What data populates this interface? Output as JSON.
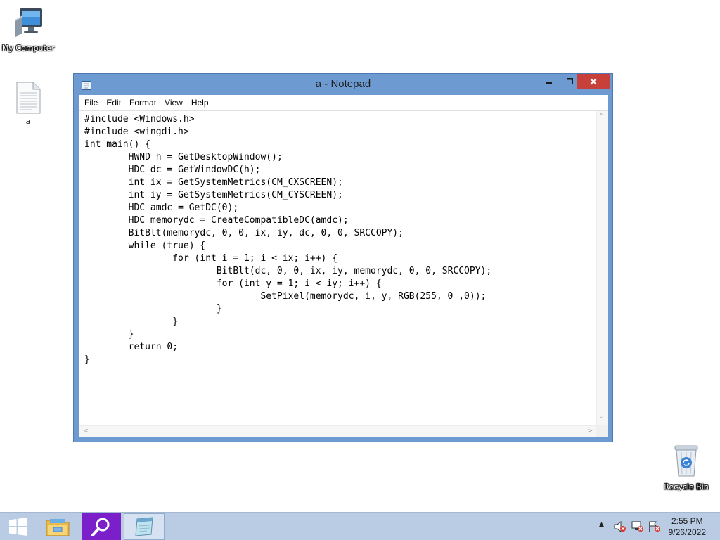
{
  "desktop": {
    "icons": [
      {
        "label": "My Computer",
        "icon": "computer-icon"
      },
      {
        "label": "a",
        "icon": "text-document-icon"
      },
      {
        "label": "Recycle Bin",
        "icon": "recycle-bin-icon"
      }
    ]
  },
  "window": {
    "title": "a - Notepad",
    "app_icon": "notepad-icon",
    "controls": {
      "minimize": "minimize-icon",
      "maximize": "maximize-icon",
      "close": "close-icon"
    },
    "menu": [
      "File",
      "Edit",
      "Format",
      "View",
      "Help"
    ],
    "content": "#include <Windows.h>\n#include <wingdi.h>\nint main() {\n\tHWND h = GetDesktopWindow();\n\tHDC dc = GetWindowDC(h);\n\tint ix = GetSystemMetrics(CM_CXSCREEN);\n\tint iy = GetSystemMetrics(CM_CYSCREEN);\n\tHDC amdc = GetDC(0);\n\tHDC memorydc = CreateCompatibleDC(amdc);\n\tBitBlt(memorydc, 0, 0, ix, iy, dc, 0, 0, SRCCOPY);\n\twhile (true) {\n\t\tfor (int i = 1; i < ix; i++) {\n\t\t\tBitBlt(dc, 0, 0, ix, iy, memorydc, 0, 0, SRCCOPY);\n\t\t\tfor (int y = 1; i < iy; i++) {\n\t\t\t\tSetPixel(memorydc, i, y, RGB(255, 0 ,0));\n\t\t\t}\n\t\t}\n\t}\n\treturn 0;\n}"
  },
  "taskbar": {
    "start": "windows-logo-icon",
    "pinned": [
      {
        "icon": "file-explorer-icon"
      },
      {
        "icon": "search-app-icon"
      },
      {
        "icon": "notepad-icon",
        "active": true
      }
    ],
    "tray": [
      "show-hidden-icons-chevron",
      "speaker-muted-icon",
      "network-error-icon",
      "action-center-flag-icon"
    ],
    "time": "2:55 PM",
    "date": "9/26/2022"
  },
  "colors": {
    "window_frame": "#6d9ad0",
    "close_button": "#c7403a",
    "taskbar": "#b9cce4",
    "search_app": "#7a1fc9"
  }
}
